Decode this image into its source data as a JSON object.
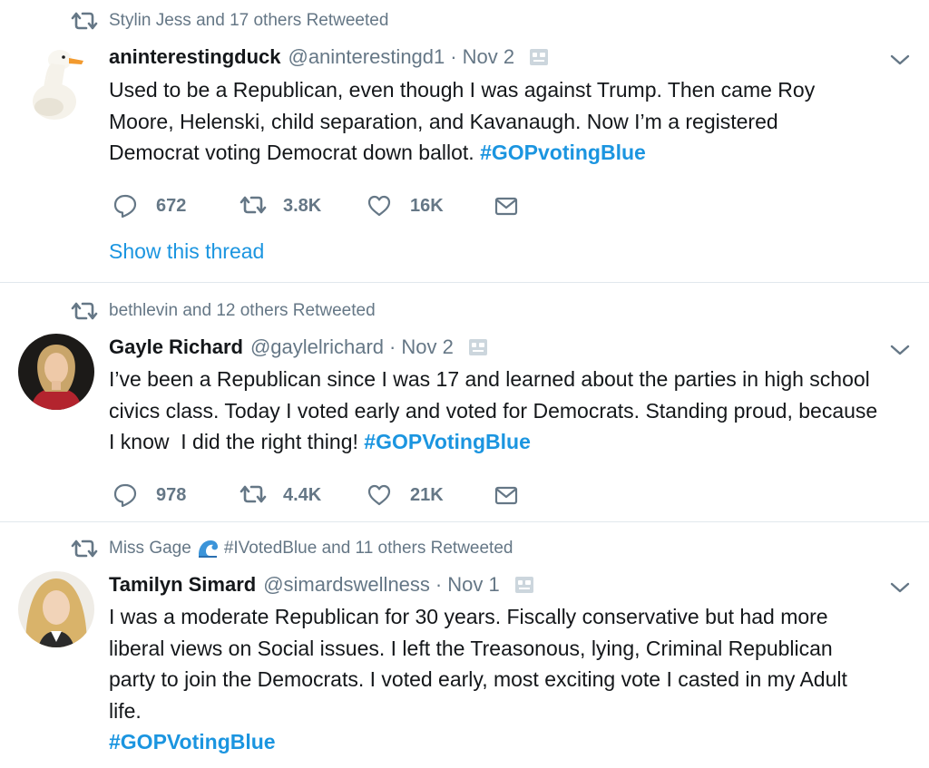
{
  "tweets": [
    {
      "retweeted_by": "Stylin Jess and 17 others Retweeted",
      "display_name": "aninterestingduck",
      "handle": "@aninterestingd1",
      "separator": "·",
      "date": "Nov 2",
      "body_lines": [
        "Used to be a Republican, even though I was against Trump. Then came Roy",
        "Moore, Helenski, child separation, and Kavanaugh. Now I’m a registered",
        "Democrat voting Democrat down ballot."
      ],
      "hashtag": "#GOPvotingBlue",
      "replies": "672",
      "retweets": "3.8K",
      "likes": "16K",
      "show_thread": "Show this thread"
    },
    {
      "retweeted_by": "bethlevin and 12 others Retweeted",
      "display_name": "Gayle Richard",
      "handle": "@gaylelrichard",
      "separator": "·",
      "date": "Nov 2",
      "body_lines": [
        "I’ve been a Republican since I was 17 and learned about the parties in high school",
        "civics class. Today I voted early and voted for Democrats. Standing proud, because",
        "I know  I did the right thing! "
      ],
      "hashtag": "#GOPVotingBlue",
      "replies": "978",
      "retweets": "4.4K",
      "likes": "21K"
    },
    {
      "retweeted_by_prefix": "Miss Gage",
      "retweeted_by_suffix": "#IVotedBlue and 11 others Retweeted",
      "display_name": "Tamilyn Simard",
      "handle": "@simardswellness",
      "separator": "·",
      "date": "Nov 1",
      "body_lines": [
        "I was a moderate Republican for 30 years. Fiscally conservative but had more",
        "liberal views on Social issues. I left the Treasonous, lying, Criminal Republican",
        "party to join the Democrats. I voted early, most exciting vote I casted in my Adult",
        "life."
      ],
      "hashtag": "#GOPVotingBlue"
    }
  ],
  "icons": {
    "retweet": "retweet-icon",
    "reply": "reply-icon",
    "like": "heart-icon",
    "message": "envelope-icon",
    "translate": "translate-icon",
    "caret": "chevron-down-icon",
    "wave": "water-wave-emoji"
  },
  "colors": {
    "text": "#14171a",
    "secondary": "#657786",
    "link": "#1b95e0",
    "divider": "#e1e8ed"
  }
}
